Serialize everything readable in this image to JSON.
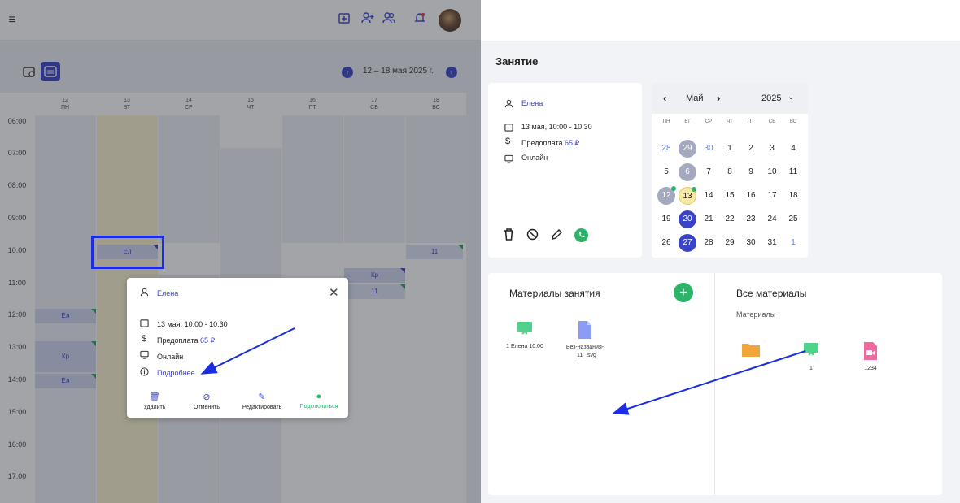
{
  "header": {
    "menu_icon": "menu-icon",
    "icons": [
      "calendar-plus-icon",
      "add-user-icon",
      "users-icon",
      "bell-icon"
    ]
  },
  "toolbar": {
    "date_range": "12 – 18 мая 2025 г."
  },
  "days": [
    {
      "num": "12",
      "wd": "ПН"
    },
    {
      "num": "13",
      "wd": "ВТ"
    },
    {
      "num": "14",
      "wd": "СР"
    },
    {
      "num": "15",
      "wd": "ЧТ"
    },
    {
      "num": "16",
      "wd": "ПТ"
    },
    {
      "num": "17",
      "wd": "СБ"
    },
    {
      "num": "18",
      "wd": "ВС"
    }
  ],
  "hours": [
    "06:00",
    "07:00",
    "08:00",
    "09:00",
    "10:00",
    "11:00",
    "12:00",
    "13:00",
    "14:00",
    "15:00",
    "16:00",
    "17:00"
  ],
  "events": [
    {
      "label": "Ел"
    },
    {
      "label": "11"
    },
    {
      "label": "Кр"
    },
    {
      "label": "11"
    },
    {
      "label": "Ел"
    },
    {
      "label": "Кр"
    },
    {
      "label": "Ел"
    }
  ],
  "popup": {
    "student": "Елена",
    "datetime": "13 мая, 10:00 - 10:30",
    "prepay_label": "Предоплата",
    "prepay_value": "65 ₽",
    "mode": "Онлайн",
    "more": "Подробнее",
    "actions": [
      "Удалить",
      "Отменить",
      "Редактировать",
      "Подключиться"
    ]
  },
  "right": {
    "title": "Занятие",
    "student": "Елена",
    "datetime": "13 мая, 10:00 - 10:30",
    "prepay_label": "Предоплата",
    "prepay_value": "65 ₽",
    "mode": "Онлайн",
    "calendar": {
      "month": "Май",
      "year": "2025",
      "weekdays": [
        "ПН",
        "ВТ",
        "СР",
        "ЧТ",
        "ПТ",
        "СБ",
        "ВС"
      ],
      "weeks": [
        [
          "28",
          "29",
          "30",
          "1",
          "2",
          "3",
          "4"
        ],
        [
          "5",
          "6",
          "7",
          "8",
          "9",
          "10",
          "11"
        ],
        [
          "12",
          "13",
          "14",
          "15",
          "16",
          "17",
          "18"
        ],
        [
          "19",
          "20",
          "21",
          "22",
          "23",
          "24",
          "25"
        ],
        [
          "26",
          "27",
          "28",
          "29",
          "30",
          "31",
          "1"
        ]
      ]
    },
    "materials_title": "Материалы занятия",
    "all_title": "Все материалы",
    "all_subtitle": "Материалы",
    "lesson_files": [
      {
        "name": "1 Елена 10:00",
        "icon": "presentation-icon"
      },
      {
        "name": "Без-названия-_11_.svg",
        "icon": "document-icon"
      }
    ],
    "all_files": [
      {
        "name": "",
        "icon": "folder-icon"
      },
      {
        "name": "1",
        "icon": "presentation-icon"
      },
      {
        "name": "1234",
        "icon": "video-file-icon"
      }
    ]
  },
  "colors": {
    "accent": "#3a44c8",
    "green": "#2eb36a",
    "today": "#f6e8a6"
  }
}
